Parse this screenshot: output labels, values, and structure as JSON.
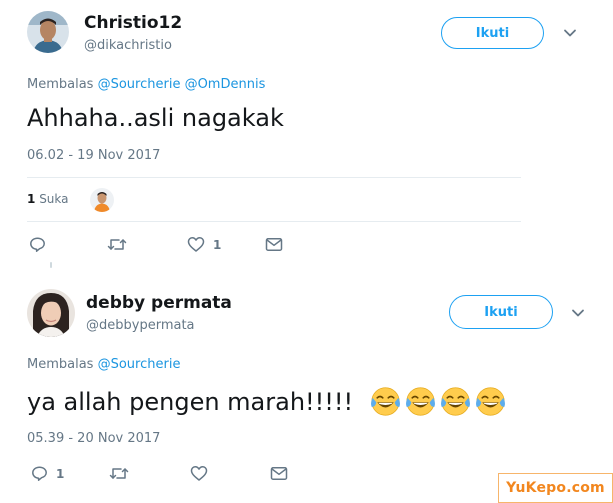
{
  "tweets": [
    {
      "display_name": "Christio12",
      "username": "@dikachristio",
      "follow_label": "Ikuti",
      "reply_prefix": "Membalas",
      "mentions": [
        "@Sourcherie",
        "@OmDennis"
      ],
      "text": "Ahhaha..asli nagakak",
      "timestamp": "06.02 - 19 Nov 2017",
      "likes": {
        "count": "1",
        "label": "Suka"
      },
      "actions": {
        "reply": "",
        "retweet": "",
        "like": "1",
        "message": ""
      }
    },
    {
      "display_name": "debby permata",
      "username": "@debbypermata",
      "follow_label": "Ikuti",
      "reply_prefix": "Membalas",
      "mentions": [
        "@Sourcherie"
      ],
      "text": "ya allah pengen marah!!!!!",
      "emoji_count": 4,
      "timestamp": "05.39 - 20 Nov 2017",
      "actions": {
        "reply": "1",
        "retweet": "",
        "like": "",
        "message": ""
      }
    }
  ],
  "watermark": "YuKepo.com",
  "colors": {
    "accent": "#1da1f2",
    "mention": "#1b95e0",
    "muted": "#657786",
    "watermark": "#f2871f"
  }
}
